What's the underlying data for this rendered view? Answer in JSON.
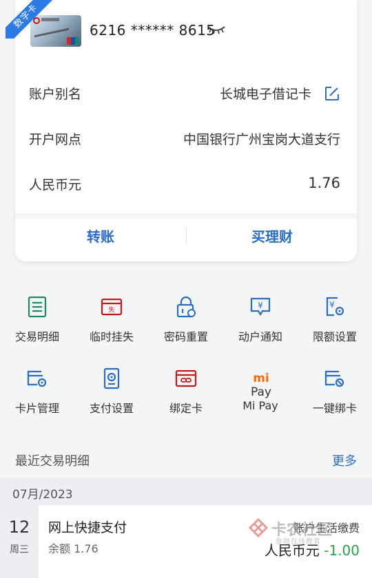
{
  "account_card": {
    "tag": "数字卡",
    "card_number": "6216 ****** 8615",
    "rows": [
      {
        "label": "账户别名",
        "value": "长城电子借记卡"
      },
      {
        "label": "开户网点",
        "value": "中国银行广州宝岗大道支行"
      },
      {
        "label": "人民币元",
        "value": "1.76"
      }
    ],
    "actions": [
      "转账",
      "买理财"
    ]
  },
  "services": [
    {
      "label": "交易明细",
      "icon": "list-icon",
      "color": "#1f8a5b"
    },
    {
      "label": "临时挂失",
      "icon": "report-loss-icon",
      "color": "#c8161d"
    },
    {
      "label": "密码重置",
      "icon": "lock-reset-icon",
      "color": "#2c6cc0"
    },
    {
      "label": "动户通知",
      "icon": "yuan-notice-icon",
      "color": "#2c6cc0"
    },
    {
      "label": "限额设置",
      "icon": "limit-settings-icon",
      "color": "#2c6cc0"
    },
    {
      "label": "卡片管理",
      "icon": "card-settings-icon",
      "color": "#2c6cc0"
    },
    {
      "label": "支付设置",
      "icon": "payment-settings-icon",
      "color": "#2c6cc0"
    },
    {
      "label": "绑定卡",
      "icon": "bind-card-icon",
      "color": "#c8161d"
    },
    {
      "label": "Mi Pay",
      "icon": "mipay-icon",
      "logo_text": "Pay",
      "color": "#ff6900"
    },
    {
      "label": "一键绑卡",
      "icon": "quick-bind-icon",
      "color": "#2c6cc0"
    }
  ],
  "recent": {
    "title": "最近交易明细",
    "more": "更多",
    "month": "07月/2023",
    "transactions": [
      {
        "day": "12",
        "weekday": "周三",
        "title": "网上快捷支付",
        "balance": "余额 1.76",
        "category": "账户生活缴费",
        "currency": "人民币元",
        "amount": "-1.00"
      }
    ]
  },
  "watermark": {
    "name": "卡农社区",
    "slogan": "金融在线教育"
  }
}
